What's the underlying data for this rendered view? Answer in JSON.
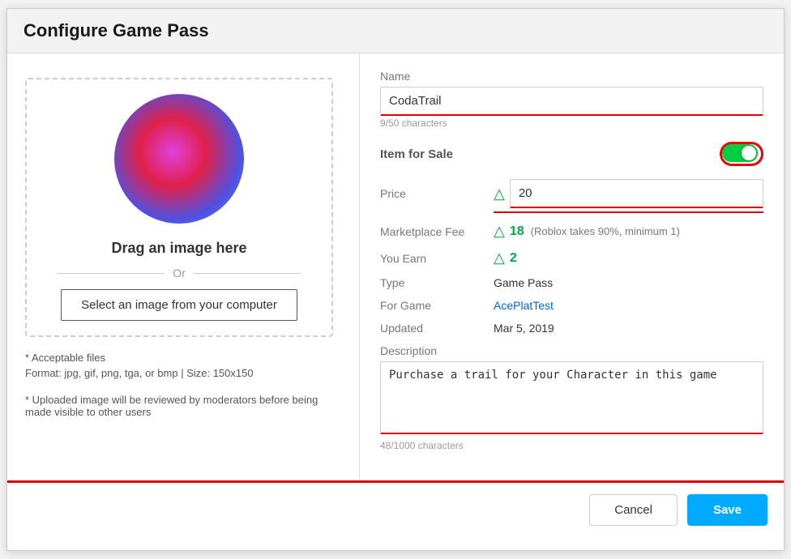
{
  "dialog": {
    "title": "Configure Game Pass"
  },
  "left": {
    "drag_text": "Drag an image here",
    "or_label": "Or",
    "select_btn_label": "Select an image from your computer",
    "acceptable_title": "* Acceptable files",
    "acceptable_details": "Format: jpg, gif, png, tga, or bmp | Size: 150x150",
    "upload_note": "* Uploaded image will be reviewed by moderators before being made visible to other users"
  },
  "form": {
    "name_label": "Name",
    "name_value": "CodaTrail",
    "name_char_count": "9/50 characters",
    "item_sale_label": "Item for Sale",
    "price_label": "Price",
    "price_value": "20",
    "marketplace_label": "Marketplace Fee",
    "marketplace_value": "18",
    "marketplace_note": "(Roblox takes 90%, minimum 1)",
    "you_earn_label": "You Earn",
    "you_earn_value": "2",
    "type_label": "Type",
    "type_value": "Game Pass",
    "for_game_label": "For Game",
    "for_game_value": "AcePlatTest",
    "updated_label": "Updated",
    "updated_value": "Mar 5, 2019",
    "description_label": "Description",
    "description_value": "Purchase a trail for your Character in this game",
    "description_char_count": "48/1000 characters"
  },
  "footer": {
    "cancel_label": "Cancel",
    "save_label": "Save"
  },
  "icons": {
    "robux": "®"
  }
}
